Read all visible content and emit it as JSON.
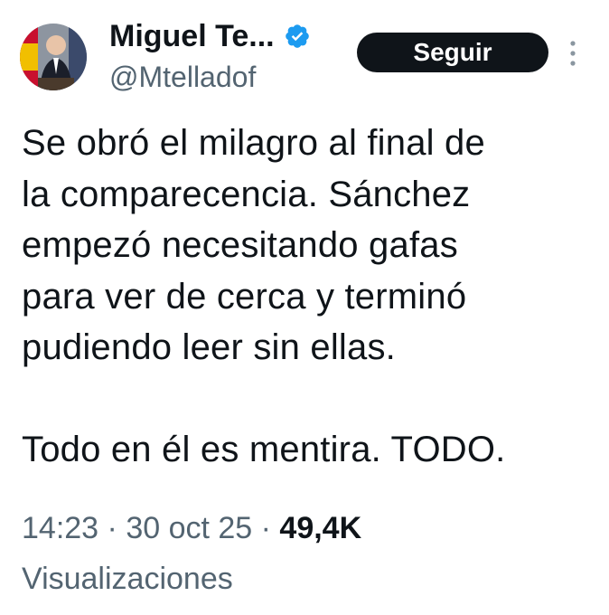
{
  "author": {
    "display_name": "Miguel Te...",
    "handle": "@Mtelladof",
    "verified": true,
    "avatar_icon": "profile-photo"
  },
  "actions": {
    "follow_label": "Seguir",
    "more_icon": "vertical-ellipsis-icon"
  },
  "tweet": {
    "paragraphs": [
      "Se obró el milagro al final de\nla comparecencia. Sánchez\nempezó necesitando gafas\npara ver de cerca y terminó\npudiendo leer sin ellas.",
      "Todo en él es mentira. TODO."
    ]
  },
  "meta": {
    "time": "14:23",
    "separator": " · ",
    "date": "30 oct 25",
    "views_count": "49,4K",
    "views_label": "Visualizaciones"
  },
  "colors": {
    "text": "#0f1419",
    "secondary": "#536471",
    "verified": "#1d9bf0",
    "button_bg": "#0f1419",
    "button_text": "#ffffff"
  }
}
